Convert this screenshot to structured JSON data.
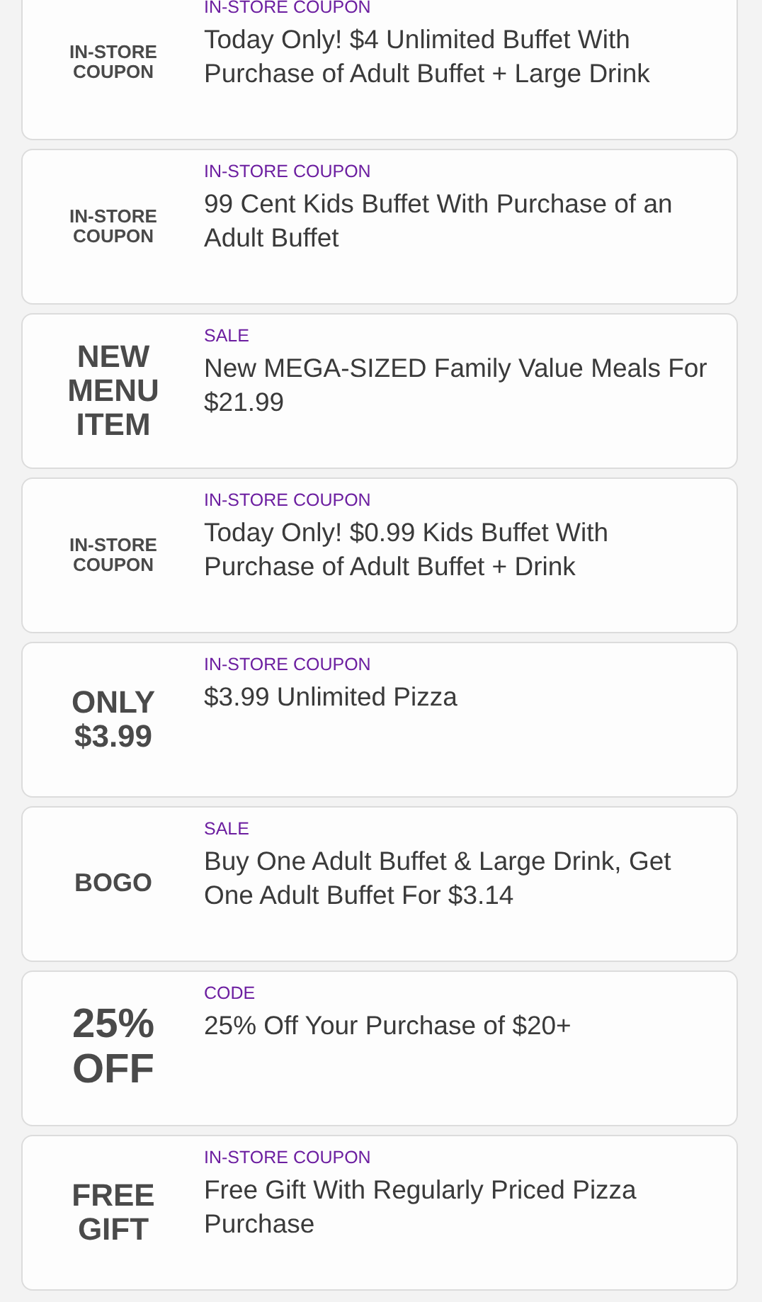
{
  "offers": [
    {
      "badge": "IN-STORE COUPON",
      "kind": "small",
      "type": "IN-STORE COUPON",
      "title": "Today Only! $4 Unlimited Buffet With Purchase of Adult Buffet + Large Drink"
    },
    {
      "badge": "IN-STORE COUPON",
      "kind": "small",
      "type": "IN-STORE COUPON",
      "title": "99 Cent Kids Buffet With Purchase of an Adult Buffet"
    },
    {
      "badge": "NEW MENU ITEM",
      "kind": "medium",
      "type": "SALE",
      "title": "New MEGA-SIZED Family Value Meals For $21.99"
    },
    {
      "badge": "IN-STORE COUPON",
      "kind": "small",
      "type": "IN-STORE COUPON",
      "title": "Today Only! $0.99 Kids Buffet With Purchase of Adult Buffet + Drink"
    },
    {
      "badge": "ONLY $3.99",
      "kind": "medium",
      "type": "IN-STORE COUPON",
      "title": "$3.99 Unlimited Pizza"
    },
    {
      "badge": "BOGO",
      "kind": "regular",
      "type": "SALE",
      "title": "Buy One Adult Buffet & Large Drink, Get One Adult Buffet For $3.14"
    },
    {
      "badge": "25% OFF",
      "kind": "large",
      "type": "CODE",
      "title": "25% Off Your Purchase of $20+"
    },
    {
      "badge": "FREE GIFT",
      "kind": "medium",
      "type": "IN-STORE COUPON",
      "title": "Free Gift With Regularly Priced Pizza Purchase"
    }
  ]
}
